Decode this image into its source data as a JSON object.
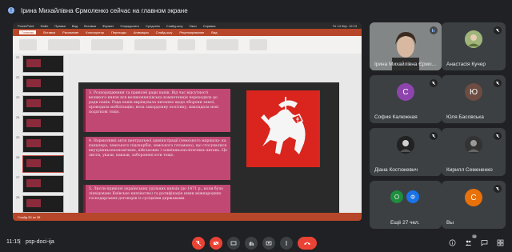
{
  "notification": {
    "text": "Ірина Михайлівна Єрмоленко сейчас на главном экране"
  },
  "presentation": {
    "menubar": [
      "PowerPoint",
      "Файл",
      "Правка",
      "Вид",
      "Вставка",
      "Формат",
      "Упорядочить",
      "Средства",
      "Слайд-шоу",
      "Окно",
      "Справка"
    ],
    "menubar_right": "Пт 14 бер. 12:13",
    "ribbon_tabs": [
      "Главная",
      "Вставка",
      "Рисование",
      "Конструктор",
      "Переходы",
      "Анимация",
      "Слайд-шоу",
      "Рецензирование",
      "Вид"
    ],
    "active_ribbon_tab": "Главная",
    "slide_numbers": [
      "21",
      "22",
      "23",
      "24",
      "25",
      "26",
      "27",
      "28"
    ],
    "selected_slide_index": 5,
    "status": "Слайд 26 из 38",
    "text_blocks": [
      "3. Розпорядження та привілеї ради панів. Від час відсутності великого князя вся великокнязівська компетенція переходила до ради панів. Рада панів вирішувала питання щодо оборони землі, проводила мобілізацію, вела закордонну політику, накладала нові податкові тощо.",
      "4. Нормативні акти центральної адміністрації (земського маршала- ка канцлера, земського підскарбія, земського гетьмана), що стосувалися внутрішньоекономічних, військових і зовнішньополітичних питань. Це листи, укази, накази, заборонені юти тощо.",
      "5. Листи-привілеї українських удільних князів (до 1471 р., коли було ліквідовано Київське князівство) та ратифікація ними міжнародних господарських договорів із сусідніми державами."
    ]
  },
  "participants": [
    {
      "name": "Ірина Михайлівна Єрмо...",
      "kind": "video",
      "color": "#7a7d7f"
    },
    {
      "name": "Анастасія Кучер",
      "kind": "photo",
      "color": "#8fa36b"
    },
    {
      "name": "София Калюжная",
      "kind": "letter",
      "letter": "С",
      "color": "#8e44ad"
    },
    {
      "name": "Юля Басовська",
      "kind": "letter",
      "letter": "Ю",
      "color": "#6d4c41"
    },
    {
      "name": "Діана Костюкевич",
      "kind": "photo",
      "color": "#2b2b2b"
    },
    {
      "name": "Кирилл Семененко",
      "kind": "photo",
      "color": "#3a3a3a"
    },
    {
      "name": "Ещё 27 чел.",
      "kind": "group",
      "color": "#5f6368"
    },
    {
      "name": "Вы",
      "kind": "letter",
      "letter": "С",
      "color": "#e8710a"
    }
  ],
  "bottom": {
    "time": "11:15",
    "separator": "|",
    "meeting_code": "psp-doci-ija",
    "participants_count": "35"
  }
}
